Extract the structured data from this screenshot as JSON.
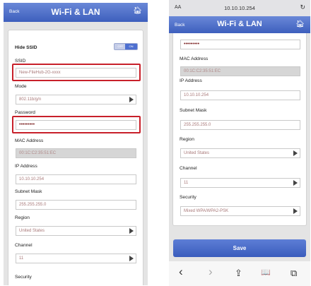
{
  "left": {
    "header": {
      "back": "Back",
      "title": "Wi-Fi & LAN",
      "home_icon": "home-icon"
    },
    "hide_ssid": {
      "label": "Hide SSID",
      "toggle_off": "OFF",
      "toggle_on": "ON"
    },
    "ssid": {
      "label": "SSID",
      "value": "New-FileHub-2G-xxxx"
    },
    "mode": {
      "label": "Mode",
      "value": "802.11b/g/n"
    },
    "password": {
      "label": "Password",
      "value": "•••••••••"
    },
    "mac": {
      "label": "MAC Address",
      "value": "00:1C:C2:35:51:EC"
    },
    "ip": {
      "label": "IP Address",
      "value": "10.10.10.254"
    },
    "subnet": {
      "label": "Subnet Mask",
      "value": "255.255.255.0"
    },
    "region": {
      "label": "Region",
      "value": "United States"
    },
    "channel": {
      "label": "Channel",
      "value": "11"
    },
    "security": {
      "label": "Security"
    }
  },
  "right": {
    "urlbar": {
      "aa": "AA",
      "url": "10.10.10.254",
      "reload": "↻"
    },
    "header": {
      "back": "Back",
      "title": "Wi-Fi & LAN"
    },
    "password": {
      "value": "•••••••••"
    },
    "mac": {
      "label": "MAC Address",
      "value": "00:1C:C2:35:51:EC"
    },
    "ip": {
      "label": "IP Address",
      "value": "10.10.10.254"
    },
    "subnet": {
      "label": "Subnet Mask",
      "value": "255.255.255.0"
    },
    "region": {
      "label": "Region",
      "value": "United States"
    },
    "channel": {
      "label": "Channel",
      "value": "11"
    },
    "security": {
      "label": "Security",
      "value": "Mixed WPA/WPA2-PSK"
    },
    "save": "Save",
    "toolbar": {
      "back": "‹",
      "forward": "›",
      "share": "⇪",
      "bookmarks": "📖",
      "tabs": "⧉"
    }
  },
  "colors": {
    "header": "#3d5fbd",
    "highlight": "#c8202a",
    "card": "#ffffff",
    "background": "#e4e4e4"
  }
}
